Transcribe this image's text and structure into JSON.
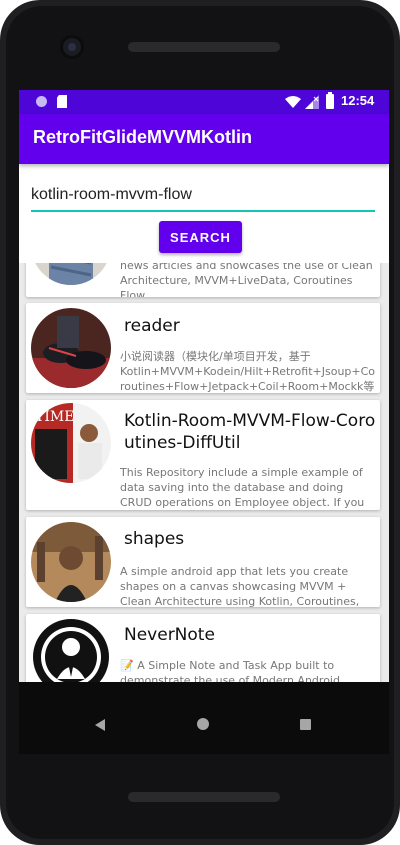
{
  "status_bar": {
    "time": "12:54"
  },
  "app_bar": {
    "title": "RetroFitGlideMVVMKotlin"
  },
  "search": {
    "value": "kotlin-room-mvvm-flow",
    "button_label": "SEARCH"
  },
  "results": [
    {
      "title": "",
      "description": "news articles and showcases the use of Clean Architecture, MVVM+LiveData, Coroutines Flow,"
    },
    {
      "title": "reader",
      "description": "小说阅读器（模块化/单项目开发，基于Kotlin+MVVM+Kodein/Hilt+Retrofit+Jsoup+Coroutines+Flow+Jetpack+Coil+Room+Mockk等架构实"
    },
    {
      "title": "Kotlin-Room-MVVM-Flow-Coroutines-DiffUtil",
      "description": "This Repository include a simple example of data saving into the database and doing CRUD operations on Employee object. If you try to add new employee"
    },
    {
      "title": "shapes",
      "description": "A simple android app that lets you create shapes on a canvas showcasing MVVM + Clean Architecture using Kotlin, Coroutines, Flow, ViewModel, LiveData,"
    },
    {
      "title": "NeverNote",
      "description": "📝 A Simple Note and Task App built to demonstrate the use of Modern Android development tools - (Kotlin, Coroutines, Flow, Architecture Components,"
    }
  ],
  "colors": {
    "status_bar": "#4e06d8",
    "primary": "#6200ee",
    "accent": "#14c4b4"
  },
  "icons": [
    "notification-dot-icon",
    "sd-card-icon",
    "wifi-icon",
    "signal-icon",
    "battery-icon",
    "back-icon",
    "home-icon",
    "recents-icon"
  ]
}
